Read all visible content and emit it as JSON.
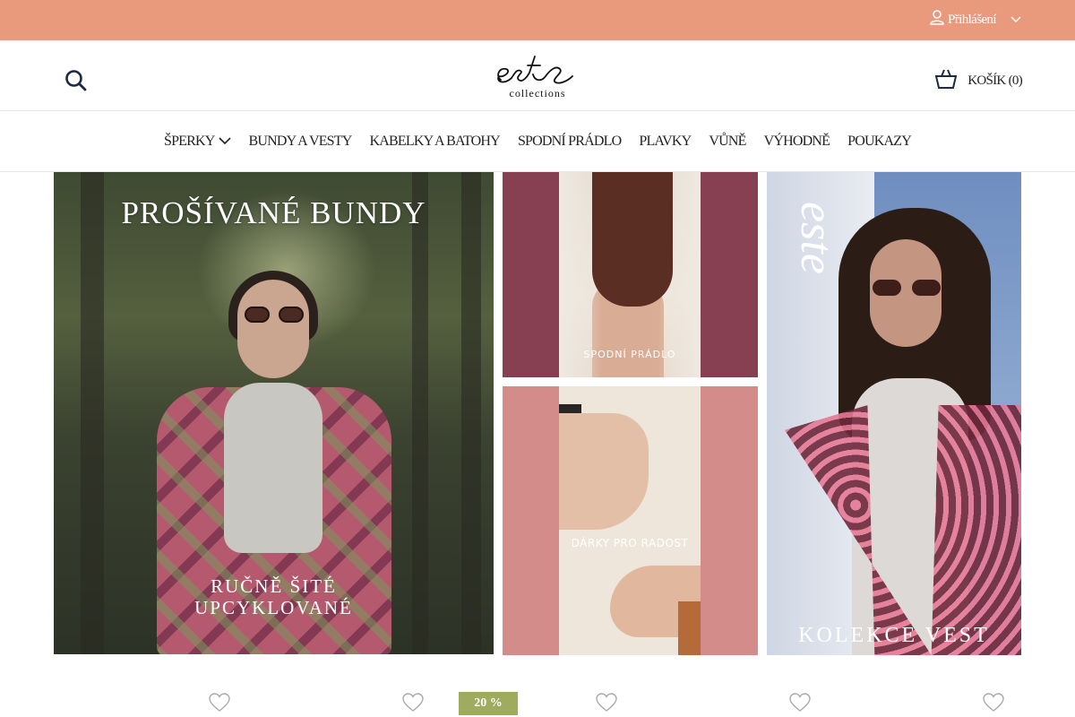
{
  "topbar": {
    "login_label": "Přihlášení",
    "bg_color": "#e99a7c"
  },
  "header": {
    "logo_word": "este",
    "logo_sub": "collections",
    "cart_label": "KOŠÍK (0)"
  },
  "nav": {
    "items": [
      {
        "label": "ŠPERKY",
        "has_dropdown": true
      },
      {
        "label": "BUNDY A VESTY"
      },
      {
        "label": "KABELKY A BATOHY"
      },
      {
        "label": "SPODNÍ PRÁDLO"
      },
      {
        "label": "PLAVKY"
      },
      {
        "label": "VŮNĚ"
      },
      {
        "label": "VÝHODNĚ"
      },
      {
        "label": "POUKAZY"
      }
    ]
  },
  "banners": {
    "jackets": {
      "title": "PROŠÍVANÉ BUNDY",
      "subtitle_line1": "RUČNĚ ŠITÉ",
      "subtitle_line2": "UPCYKLOVANÉ"
    },
    "underwear": {
      "caption": "SPODNÍ PRÁDLO"
    },
    "gifts": {
      "caption": "DÁRKY PRO RADOST"
    },
    "vests": {
      "brand": "este",
      "caption": "KOLEKCE VEST"
    }
  },
  "products": {
    "discount_badge": "20 %",
    "wishlist_icons": [
      "heart-icon",
      "heart-icon",
      "heart-icon",
      "heart-icon",
      "heart-icon"
    ],
    "badge_color": "#9fab5f"
  }
}
